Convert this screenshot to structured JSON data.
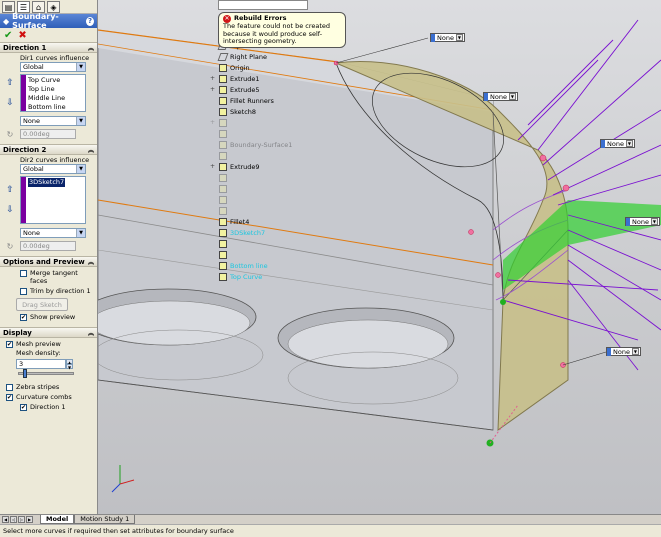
{
  "property_manager": {
    "tab_icons": [
      "feature-manager-icon",
      "property-manager-icon",
      "configuration-manager-icon",
      "display-manager-icon"
    ],
    "title": "Boundary-Surface",
    "help_label": "?",
    "ok_symbol": "✔",
    "cancel_symbol": "✖",
    "direction1": {
      "header": "Direction 1",
      "curves_influence_label": "Dir1 curves influence",
      "curves_influence_value": "Global",
      "curves": [
        "Top Curve",
        "Top Line",
        "Middle Line",
        "Bottom line"
      ],
      "tangency_value": "None",
      "angle_value": "0.00deg"
    },
    "direction2": {
      "header": "Direction 2",
      "curves_influence_label": "Dir2 curves influence",
      "curves_influence_value": "Global",
      "curves": [
        "3DSketch7"
      ],
      "tangency_value": "None",
      "angle_value": "0.00deg"
    },
    "options": {
      "header": "Options and Preview",
      "merge_tangent_faces": "Merge tangent faces",
      "trim_by_direction": "Trim by direction 1",
      "drag_sketch": "Drag Sketch",
      "show_preview": "Show preview"
    },
    "display": {
      "header": "Display",
      "mesh_preview": "Mesh preview",
      "mesh_density_label": "Mesh density:",
      "mesh_density_value": "3",
      "zebra_stripes": "Zebra stripes",
      "curvature_combs": "Curvature combs",
      "direction1": "Direction 1"
    }
  },
  "error_tooltip": {
    "title": "Rebuild Errors",
    "message": "The feature could not be created because it would produce self-intersecting geometry."
  },
  "feature_tree": [
    {
      "label": "Top Plane",
      "expand": "",
      "faded": false,
      "color": ""
    },
    {
      "label": "Right Plane",
      "expand": "",
      "faded": false,
      "color": ""
    },
    {
      "label": "Origin",
      "expand": "",
      "faded": false,
      "color": ""
    },
    {
      "label": "Extrude1",
      "expand": "+",
      "faded": false,
      "color": ""
    },
    {
      "label": "Extrude5",
      "expand": "+",
      "faded": false,
      "color": ""
    },
    {
      "label": "Fillet Runners",
      "expand": "",
      "faded": false,
      "color": ""
    },
    {
      "label": "Sketch8",
      "expand": "",
      "faded": false,
      "color": ""
    },
    {
      "label": "",
      "expand": "+",
      "faded": true,
      "color": ""
    },
    {
      "label": "",
      "expand": "",
      "faded": true,
      "color": ""
    },
    {
      "label": "Boundary-Surface1",
      "expand": "",
      "faded": true,
      "color": ""
    },
    {
      "label": "",
      "expand": "",
      "faded": true,
      "color": ""
    },
    {
      "label": "Extrude9",
      "expand": "+",
      "faded": false,
      "color": ""
    },
    {
      "label": "",
      "expand": "",
      "faded": true,
      "color": ""
    },
    {
      "label": "",
      "expand": "",
      "faded": true,
      "color": ""
    },
    {
      "label": "",
      "expand": "",
      "faded": true,
      "color": ""
    },
    {
      "label": "",
      "expand": "",
      "faded": true,
      "color": ""
    },
    {
      "label": "Fillet4",
      "expand": "",
      "faded": false,
      "color": ""
    },
    {
      "label": "3DSketch7",
      "expand": "",
      "faded": false,
      "color": "cyan"
    },
    {
      "label": "",
      "expand": "",
      "faded": false,
      "color": "cyan"
    },
    {
      "label": "",
      "expand": "",
      "faded": false,
      "color": "cyan"
    },
    {
      "label": "Bottom line",
      "expand": "",
      "faded": false,
      "color": "cyan"
    },
    {
      "label": "Top Curve",
      "expand": "",
      "faded": false,
      "color": "cyan"
    }
  ],
  "viewport": {
    "callouts": [
      "None",
      "None",
      "None",
      "None",
      "None"
    ],
    "colors": {
      "surface": "#c8c08a",
      "body": "#c7c9cf",
      "edge_orange": "#e07a10",
      "comb_purple": "#7a10d0",
      "mesh_green": "#30d030",
      "bg_top": "#dcdde0"
    }
  },
  "bottom_tabs": {
    "model": "Model",
    "motion_study": "Motion Study 1"
  },
  "status_bar": "Select more curves if required then set attributes for boundary surface"
}
